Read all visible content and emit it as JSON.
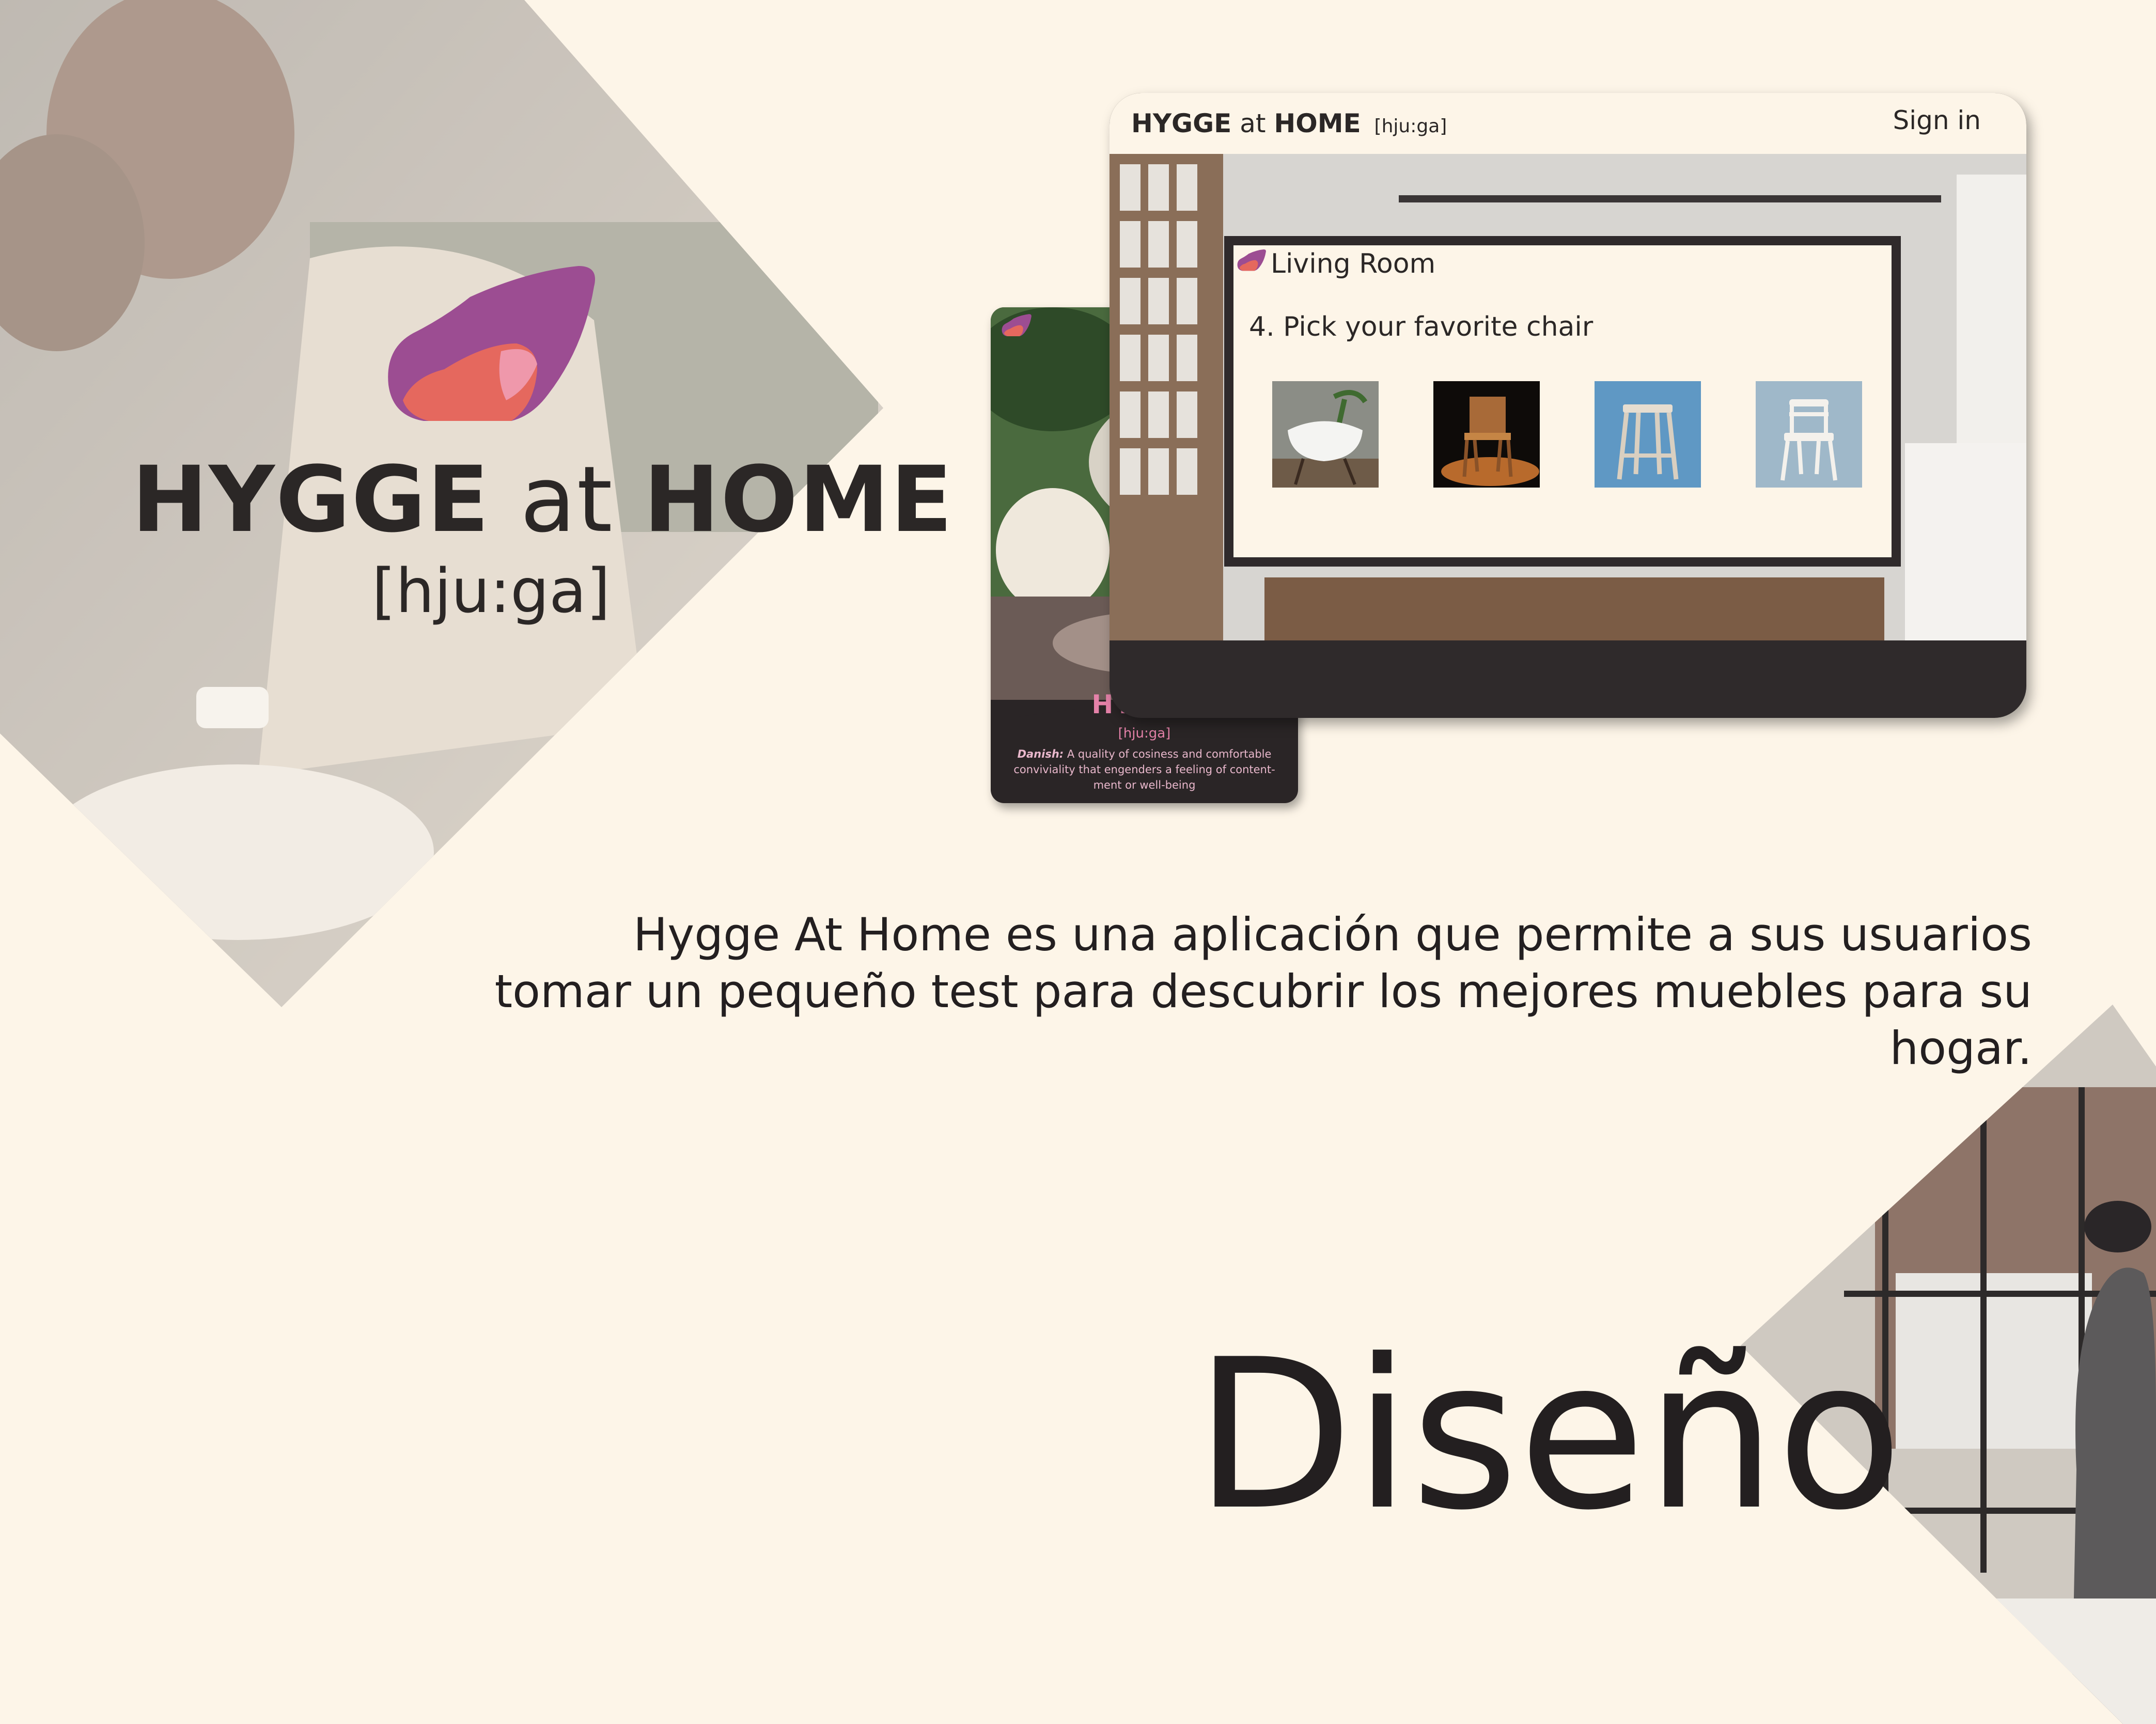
{
  "brand": {
    "name_bold_1": "HYGGE",
    "name_light": "at",
    "name_bold_2": "HOME",
    "phonetic": "[hju:ga]"
  },
  "desktop_app": {
    "header": {
      "brand_bold_1": "HYGGE",
      "brand_light": "at",
      "brand_bold_2": "HOME",
      "phonetic": "[hju:ga]",
      "signin_label": "Sign in"
    },
    "quiz": {
      "category": "Living Room",
      "question": "4. Pick your favorite chair",
      "choices": [
        {
          "icon": "white-shell-chair-image"
        },
        {
          "icon": "wooden-chair-image"
        },
        {
          "icon": "stool-image"
        },
        {
          "icon": "white-bistro-chair-image"
        }
      ]
    }
  },
  "mobile_app": {
    "word": "HYGGE",
    "phonetic": "[hju:ga]",
    "definition_lang": "Danish:",
    "definition_text": "A quality of cosiness and comfortable conviviality that engenders a feeling of content-ment or well-being"
  },
  "description": "Hygge At Home es una aplicación que permite a sus usuarios tomar un pequeño test para descubrir los mejores muebles para su hogar.",
  "heading": "Diseño",
  "colors": {
    "background": "#fdf5e8",
    "text": "#231f20",
    "logo_purple": "#9c4d92",
    "logo_coral": "#e5685e",
    "accent_pink": "#e582a9"
  }
}
